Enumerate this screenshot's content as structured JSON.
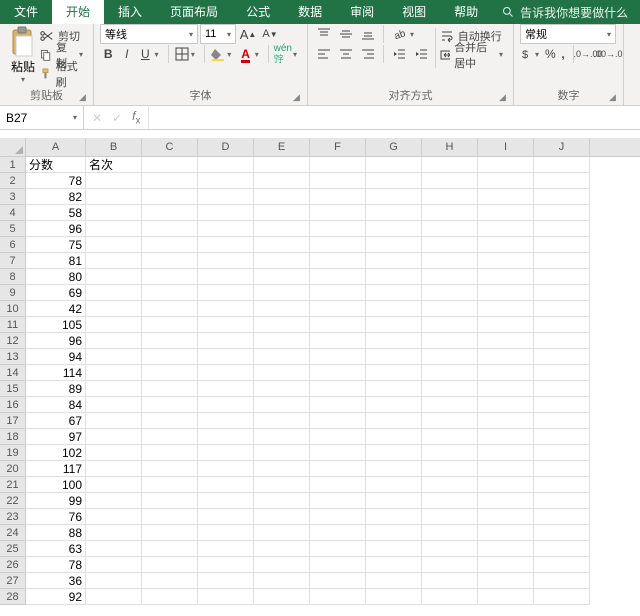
{
  "tabs": {
    "file": "文件",
    "home": "开始",
    "insert": "插入",
    "layout": "页面布局",
    "formulas": "公式",
    "data": "数据",
    "review": "审阅",
    "view": "视图",
    "help": "帮助",
    "tellme": "告诉我你想要做什么"
  },
  "ribbon": {
    "paste_label": "粘贴",
    "cut": "剪切",
    "copy": "复制",
    "format_painter": "格式刷",
    "group_clipboard": "剪贴板",
    "font_name": "等线",
    "font_size": "11",
    "group_font": "字体",
    "wrap_text": "自动换行",
    "merge_center": "合并后居中",
    "group_align": "对齐方式",
    "number_format": "常规",
    "group_number": "数字"
  },
  "namebox": "B27",
  "sheet": {
    "columns": [
      "A",
      "B",
      "C",
      "D",
      "E",
      "F",
      "G",
      "H",
      "I",
      "J"
    ],
    "headers": {
      "A1": "分数",
      "B1": "名次"
    },
    "colA_values": [
      78,
      82,
      58,
      96,
      75,
      81,
      80,
      69,
      42,
      105,
      96,
      94,
      114,
      89,
      84,
      67,
      97,
      102,
      117,
      100,
      99,
      76,
      88,
      63,
      78,
      36,
      92
    ],
    "row_count": 28
  }
}
